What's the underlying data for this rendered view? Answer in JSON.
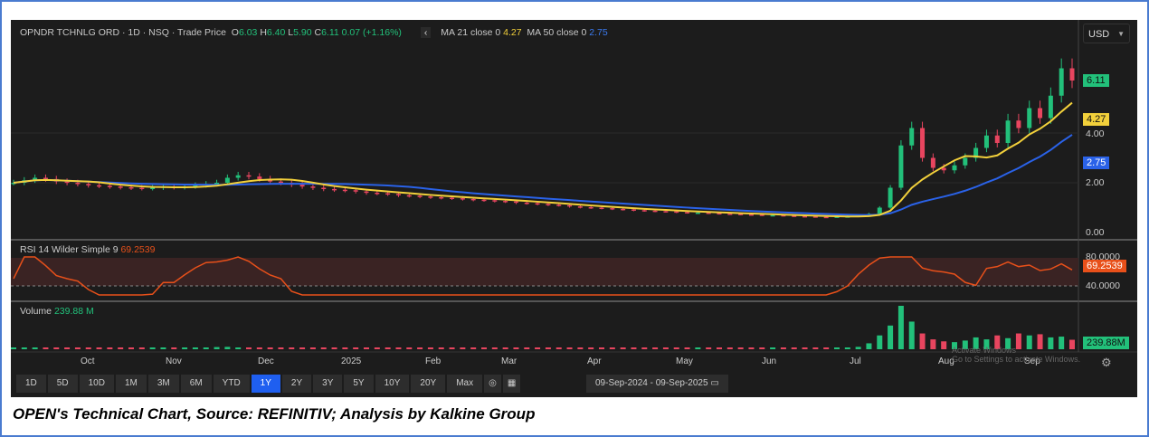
{
  "header": {
    "instrument": "OPNDR TCHNLG ORD · 1D · NSQ · Trade Price",
    "open_label": "O",
    "open": "6.03",
    "high_label": "H",
    "high": "6.40",
    "low_label": "L",
    "low": "5.90",
    "close_label": "C",
    "close": "6.11",
    "change": "0.07 (+1.16%)",
    "ma21_label": "MA 21 close 0",
    "ma21": "4.27",
    "ma50_label": "MA 50 close 0",
    "ma50": "2.75",
    "currency": "USD"
  },
  "rsi": {
    "label": "RSI 14 Wilder Simple 9",
    "value": "69.2539",
    "levels": [
      "80.0000",
      "40.0000"
    ]
  },
  "volume": {
    "label": "Volume",
    "value": "239.88 M",
    "tag": "239.88M"
  },
  "timeframes": [
    "1D",
    "5D",
    "10D",
    "1M",
    "3M",
    "6M",
    "YTD",
    "1Y",
    "2Y",
    "3Y",
    "5Y",
    "10Y",
    "20Y",
    "Max"
  ],
  "active_timeframe": "1Y",
  "date_range": {
    "from": "09-Sep-2024",
    "to": "09-Sep-2025"
  },
  "watermark": "Activate Windows\nGo to Settings to activate Windows.",
  "caption": "OPEN's Technical Chart, Source: REFINITIV; Analysis by Kalkine Group",
  "colors": {
    "up": "#22c07a",
    "down": "#e8455f",
    "ma21": "#f2d03b",
    "ma50": "#2a62e8",
    "rsi": "#e8501a"
  },
  "chart_data": {
    "type": "candlestick",
    "title": "OPNDR TCHNLG ORD · 1D · NSQ",
    "months": [
      "Oct",
      "Nov",
      "Dec",
      "2025",
      "Feb",
      "Mar",
      "Apr",
      "May",
      "Jun",
      "Jul",
      "Aug",
      "Sep"
    ],
    "price_ticks": [
      "0.00",
      "2.00",
      "4.00"
    ],
    "ylim": [
      0,
      7.5
    ],
    "closes": [
      2.0,
      2.1,
      2.2,
      2.15,
      2.05,
      2.0,
      1.95,
      1.9,
      1.88,
      1.85,
      1.82,
      1.8,
      1.78,
      1.8,
      1.85,
      1.82,
      1.85,
      1.9,
      1.95,
      2.0,
      2.2,
      2.3,
      2.25,
      2.15,
      2.05,
      2.0,
      1.92,
      1.85,
      1.8,
      1.75,
      1.72,
      1.7,
      1.65,
      1.6,
      1.58,
      1.55,
      1.5,
      1.48,
      1.45,
      1.42,
      1.4,
      1.38,
      1.35,
      1.32,
      1.3,
      1.27,
      1.25,
      1.2,
      1.18,
      1.15,
      1.12,
      1.1,
      1.05,
      1.02,
      1.0,
      0.98,
      0.95,
      0.93,
      0.9,
      0.88,
      0.86,
      0.85,
      0.82,
      0.8,
      0.8,
      0.78,
      0.76,
      0.75,
      0.73,
      0.72,
      0.7,
      0.7,
      0.68,
      0.66,
      0.65,
      0.63,
      0.62,
      0.64,
      0.65,
      0.68,
      0.75,
      1.0,
      1.8,
      3.5,
      4.2,
      3.0,
      2.6,
      2.5,
      2.7,
      3.0,
      3.4,
      3.9,
      3.6,
      4.5,
      4.2,
      5.0,
      4.6,
      5.5,
      6.6,
      6.11
    ],
    "volume_m": [
      30,
      45,
      35,
      25,
      20,
      22,
      18,
      20,
      15,
      18,
      20,
      16,
      15,
      18,
      20,
      16,
      22,
      25,
      30,
      55,
      60,
      40,
      30,
      25,
      20,
      18,
      22,
      20,
      18,
      16,
      15,
      18,
      20,
      16,
      14,
      15,
      18,
      16,
      14,
      15,
      20,
      16,
      14,
      15,
      18,
      16,
      14,
      13,
      15,
      14,
      16,
      18,
      15,
      14,
      13,
      15,
      14,
      16,
      18,
      15,
      14,
      13,
      15,
      14,
      16,
      15,
      14,
      13,
      15,
      16,
      14,
      15,
      18,
      16,
      20,
      25,
      30,
      35,
      40,
      60,
      150,
      350,
      600,
      1100,
      700,
      400,
      250,
      200,
      180,
      220,
      300,
      250,
      350,
      280,
      400,
      350,
      380,
      300,
      320,
      239.88
    ]
  }
}
